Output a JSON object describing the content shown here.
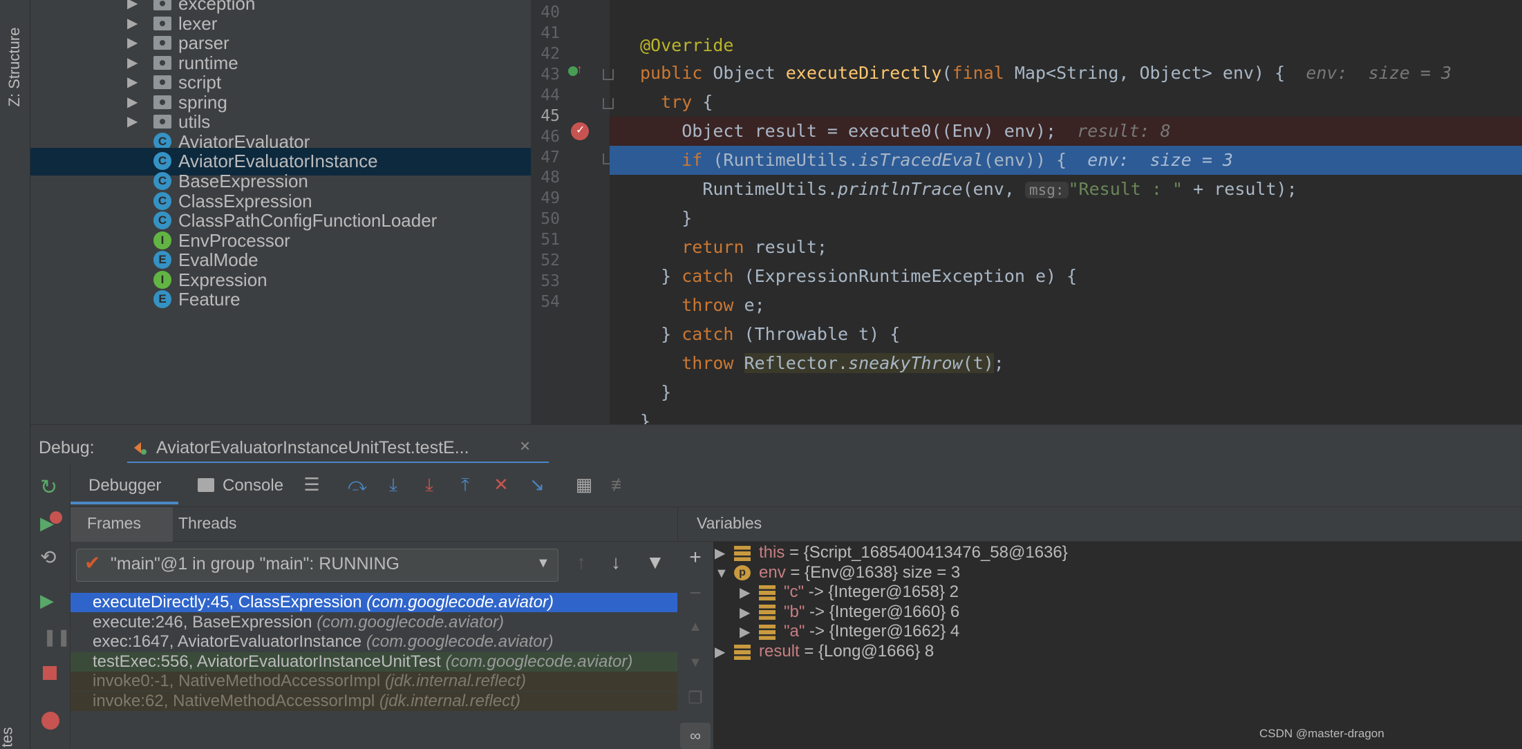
{
  "sidebar": {
    "structure_tab": "Z: Structure",
    "bottom_tab": "tes"
  },
  "project_tree": {
    "items": [
      {
        "label": "exception",
        "kind": "folder"
      },
      {
        "label": "lexer",
        "kind": "folder"
      },
      {
        "label": "parser",
        "kind": "folder"
      },
      {
        "label": "runtime",
        "kind": "folder"
      },
      {
        "label": "script",
        "kind": "folder"
      },
      {
        "label": "spring",
        "kind": "folder"
      },
      {
        "label": "utils",
        "kind": "folder"
      },
      {
        "label": "AviatorEvaluator",
        "kind": "class",
        "badge": "C"
      },
      {
        "label": "AviatorEvaluatorInstance",
        "kind": "class",
        "badge": "C",
        "selected": true
      },
      {
        "label": "BaseExpression",
        "kind": "class",
        "badge": "C"
      },
      {
        "label": "ClassExpression",
        "kind": "class",
        "badge": "C"
      },
      {
        "label": "ClassPathConfigFunctionLoader",
        "kind": "class",
        "badge": "C"
      },
      {
        "label": "EnvProcessor",
        "kind": "interface",
        "badge": "I"
      },
      {
        "label": "EvalMode",
        "kind": "enum",
        "badge": "E"
      },
      {
        "label": "Expression",
        "kind": "interface",
        "badge": "I"
      },
      {
        "label": "Feature",
        "kind": "enum",
        "badge": "E"
      }
    ]
  },
  "editor": {
    "line_numbers": [
      "40",
      "41",
      "42",
      "43",
      "44",
      "45",
      "46",
      "47",
      "48",
      "49",
      "50",
      "51",
      "52",
      "53",
      "54"
    ],
    "current_line": "45",
    "breakpoint_line": "44",
    "code": {
      "l41": "@Override",
      "l42_pre": "public Object ",
      "l42_fn": "executeDirectly",
      "l42_post_a": "(",
      "l42_final": "final",
      "l42_post_b": " Map<String, Object> env) {",
      "l42_hint": "env:  size = 3",
      "l43_kw": "try",
      "l43_rest": " {",
      "l44_code": "Object result = execute0((Env) env);",
      "l44_hint": "result: 8",
      "l45_kw": "if",
      "l45_a": " (RuntimeUtils.",
      "l45_it": "isTracedEval",
      "l45_b": "(env)) {",
      "l45_hint": "env:  size = 3",
      "l46_a": "RuntimeUtils.",
      "l46_it": "printlnTrace",
      "l46_b": "(env, ",
      "l46_pill": "msg:",
      "l46_str": "\"Result : \"",
      "l46_c": " + result);",
      "l47": "}",
      "l48_kw": "return",
      "l48_rest": " result;",
      "l49_a": "} ",
      "l49_kw": "catch",
      "l49_b": " (ExpressionRuntimeException e) {",
      "l50_kw": "throw",
      "l50_rest": " e;",
      "l51_a": "} ",
      "l51_kw": "catch",
      "l51_b": " (Throwable t) {",
      "l52_kw": "throw",
      "l52_a": "Reflector.",
      "l52_it": "sneakyThrow",
      "l52_b": "(t)",
      "l52_c": ";",
      "l53": "}",
      "l54": "}"
    }
  },
  "debug": {
    "label": "Debug:",
    "session_tab": "AviatorEvaluatorInstanceUnitTest.testE...",
    "tabs": {
      "debugger": "Debugger",
      "console": "Console"
    },
    "subtabs": {
      "frames": "Frames",
      "threads": "Threads"
    },
    "thread_selector": "\"main\"@1 in group \"main\": RUNNING",
    "frames": [
      {
        "method": "executeDirectly:45, ClassExpression ",
        "pkg": "(com.googlecode.aviator)",
        "state": "selected"
      },
      {
        "method": "execute:246, BaseExpression ",
        "pkg": "(com.googlecode.aviator)",
        "state": "normal"
      },
      {
        "method": "exec:1647, AviatorEvaluatorInstance ",
        "pkg": "(com.googlecode.aviator)",
        "state": "normal"
      },
      {
        "method": "testExec:556, AviatorEvaluatorInstanceUnitTest ",
        "pkg": "(com.googlecode.aviator)",
        "state": "test"
      },
      {
        "method": "invoke0:-1, NativeMethodAccessorImpl ",
        "pkg": "(jdk.internal.reflect)",
        "state": "library"
      },
      {
        "method": "invoke:62, NativeMethodAccessorImpl ",
        "pkg": "(jdk.internal.reflect)",
        "state": "library"
      }
    ],
    "variables_title": "Variables",
    "variables": [
      {
        "name": "this",
        "value": " = {Script_1685400413476_58@1636}",
        "indent": 0,
        "expanded": false,
        "icon": "field-icon"
      },
      {
        "name": "env",
        "value": " = {Env@1638}  size = 3",
        "indent": 0,
        "expanded": true,
        "icon": "parameter-icon"
      },
      {
        "name": "\"c\"",
        "value": " -> {Integer@1658} 2",
        "indent": 1,
        "expanded": false,
        "icon": "field-icon"
      },
      {
        "name": "\"b\"",
        "value": " -> {Integer@1660} 6",
        "indent": 1,
        "expanded": false,
        "icon": "field-icon"
      },
      {
        "name": "\"a\"",
        "value": " -> {Integer@1662} 4",
        "indent": 1,
        "expanded": false,
        "icon": "field-icon"
      },
      {
        "name": "result",
        "value": " = {Long@1666} 8",
        "indent": 0,
        "expanded": false,
        "icon": "field-icon"
      }
    ]
  },
  "watermark": "CSDN @master-dragon",
  "colors": {
    "selection": "#2f65ca",
    "exec_line": "#2d5b96",
    "breakpoint_line": "#3a2323",
    "keyword": "#cc7832",
    "method": "#ffc66d",
    "string": "#6a8759",
    "annotation": "#bbb529"
  }
}
